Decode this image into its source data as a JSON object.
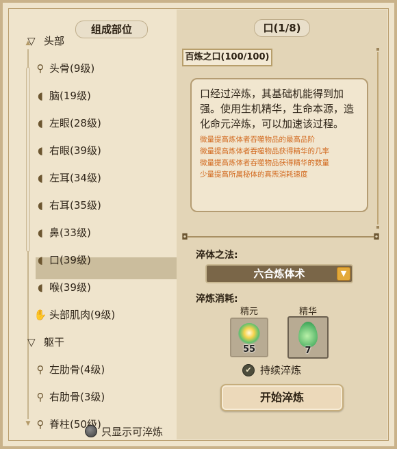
{
  "left": {
    "title": "组成部位",
    "categories": [
      {
        "label": "头部",
        "parts": [
          {
            "label": "头骨(9级)",
            "icon": "bone-icon"
          },
          {
            "label": "脑(19级)",
            "icon": "organ-icon"
          },
          {
            "label": "左眼(28级)",
            "icon": "organ-icon"
          },
          {
            "label": "右眼(39级)",
            "icon": "organ-icon"
          },
          {
            "label": "左耳(34级)",
            "icon": "organ-icon"
          },
          {
            "label": "右耳(35级)",
            "icon": "organ-icon"
          },
          {
            "label": "鼻(33级)",
            "icon": "organ-icon"
          },
          {
            "label": "口(39级)",
            "icon": "organ-icon",
            "selected": true
          },
          {
            "label": "喉(39级)",
            "icon": "organ-icon"
          },
          {
            "label": "头部肌肉(9级)",
            "icon": "muscle-icon"
          }
        ]
      },
      {
        "label": "躯干",
        "parts": [
          {
            "label": "左肋骨(4级)",
            "icon": "bone-icon"
          },
          {
            "label": "右肋骨(3级)",
            "icon": "bone-icon"
          },
          {
            "label": "脊柱(50级)",
            "icon": "bone-icon"
          }
        ]
      }
    ],
    "filter_label": "只显示可淬炼"
  },
  "right": {
    "title": "口(1/8)",
    "tab_label": "百炼之口(100/100)",
    "description": "口经过淬炼，其基础机能得到加强。使用生机精华，生命本源，造化命元淬炼，可以加速该过程。",
    "bonuses": [
      "微量提高炼体者吞噬物品的最高品阶",
      "微量提高炼体者吞噬物品获得精华的几率",
      "微量提高炼体者吞噬物品获得精华的数量",
      "少量提高所属秘体的真炁消耗速度"
    ],
    "method_label": "淬体之法:",
    "method_value": "六合炼体术",
    "cost_label": "淬炼消耗:",
    "costs": [
      {
        "name": "精元",
        "count": "55",
        "icon": "essence-orb-icon"
      },
      {
        "name": "精华",
        "count": "7",
        "icon": "green-droplet-icon"
      }
    ],
    "continuous_label": "持续淬炼",
    "continuous_checked": true,
    "start_button": "开始淬炼"
  }
}
